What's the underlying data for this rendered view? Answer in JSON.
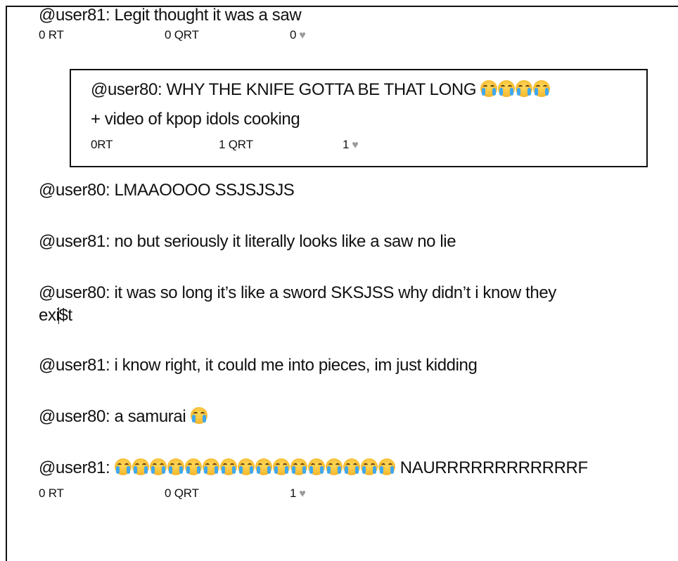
{
  "posts": {
    "p1": {
      "text": "@user81: Legit thought it was a saw"
    },
    "p1_stats": {
      "rt": "0 RT",
      "qrt": "0 QRT",
      "likes": "0"
    },
    "quote": {
      "line1": "@user80: WHY THE KNIFE GOTTA BE THAT LONG",
      "line2": "+ video of kpop idols cooking",
      "rt": "0RT",
      "qrt": "1 QRT",
      "likes": "1"
    },
    "p2": {
      "text": "@user80: LMAAOOOO SSJSJSJS"
    },
    "p3": {
      "text": "@user81: no but seriously it literally looks like a saw no lie"
    },
    "p4": {
      "line1": "@user80: it was so long it’s like a sword SKSJSS why didn’t i know they",
      "line2a": "exi",
      "line2b": "$t"
    },
    "p5": {
      "text": "@user81: i know right, it could me into pieces, im just kidding"
    },
    "p6": {
      "text": "@user80: a samurai"
    },
    "p7": {
      "prefix": "@user81:",
      "suffix": "NAURRRRRRRRRRRRF"
    },
    "p7_stats": {
      "rt": "0 RT",
      "qrt": "0 QRT",
      "likes": "1"
    }
  },
  "icons": {
    "heart": "heart-icon",
    "crying": "loudly-crying-face-emoji"
  },
  "colors": {
    "heart": "#9a9a9a",
    "border": "#111111"
  }
}
